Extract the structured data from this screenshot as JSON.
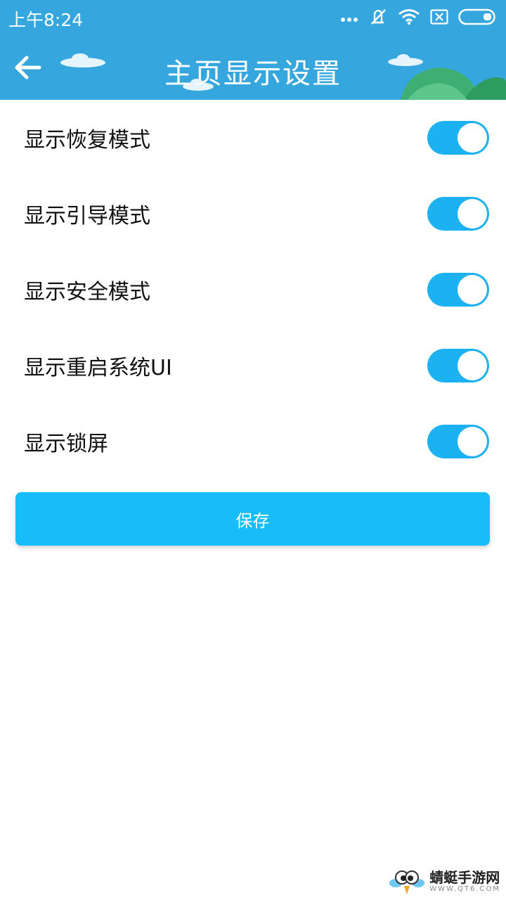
{
  "status_bar": {
    "time": "上午8:24",
    "icons": [
      "more-dots-icon",
      "mute-vibrate-icon",
      "wifi-icon",
      "no-sim-icon",
      "battery-icon"
    ]
  },
  "header": {
    "title": "主页显示设置",
    "back_icon": "back-arrow-icon",
    "color": "#36a7de"
  },
  "settings": [
    {
      "label": "显示恢复模式",
      "enabled": true
    },
    {
      "label": "显示引导模式",
      "enabled": true
    },
    {
      "label": "显示安全模式",
      "enabled": true
    },
    {
      "label": "显示重启系统UI",
      "enabled": true
    },
    {
      "label": "显示锁屏",
      "enabled": true
    }
  ],
  "save_button": {
    "label": "保存",
    "color": "#17bdf9"
  },
  "toggle_color": "#1cb1f0",
  "watermark": {
    "title": "蜻蜓手游网",
    "url": "WWW.QT6.COM"
  }
}
